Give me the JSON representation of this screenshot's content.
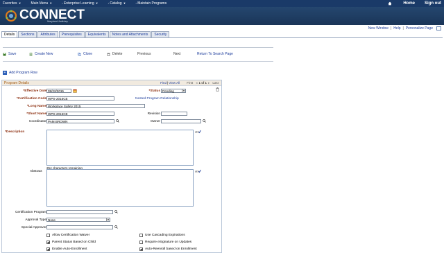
{
  "topnav": {
    "items": [
      {
        "label": "Favorites"
      },
      {
        "label": "Main Menu"
      },
      {
        "label": "Enterprise Learning"
      },
      {
        "label": "Catalog"
      },
      {
        "label": "Maintain Programs"
      }
    ],
    "home_label": "Home",
    "signout_label": "Sign out"
  },
  "brand": {
    "name": "CONNECT",
    "subtitle": "Maryland Judiciary"
  },
  "links": {
    "new_window": "New Window",
    "help": "Help",
    "personalize": "Personalize Page",
    "sep": "|"
  },
  "tabs": [
    {
      "label": "Details",
      "active": true
    },
    {
      "label": "Sections"
    },
    {
      "label": "Attributes"
    },
    {
      "label": "Prerequisites"
    },
    {
      "label": "Equivalents"
    },
    {
      "label": "Notes and Attachments"
    },
    {
      "label": "Security"
    }
  ],
  "toolbar": {
    "save": "Save",
    "create_new": "Create New",
    "clone": "Clone",
    "delete": "Delete",
    "previous": "Previous",
    "next": "Next",
    "return_search": "Return To Search Page"
  },
  "add_program_row": "Add Program Row",
  "program_details": {
    "title": "Program Details",
    "nav": {
      "find": "Find",
      "view_all": "View All",
      "first": "First",
      "pager": "1 of 1",
      "last": "Last"
    },
    "effective_date": {
      "label": "*Effective Date",
      "value": "09/22/2015"
    },
    "status": {
      "label": "*Status",
      "value": "Pending"
    },
    "cert_code": {
      "label": "*Certification Code",
      "value": "WPS-2015CE"
    },
    "nested_link": "Nested Program Relationship",
    "long_name": {
      "label": "*Long Name",
      "value": "Workplace Safety 2015"
    },
    "short_name": {
      "label": "*Short Name",
      "value": "WPS-2015CE"
    },
    "revision": {
      "label": "Revision",
      "value": ""
    },
    "coordinator": {
      "label": "Coordinator",
      "value": "PAM BROWN"
    },
    "owner": {
      "label": "Owner",
      "value": ""
    },
    "description": {
      "label": "*Description",
      "value": ""
    },
    "chars_remaining": "254 characters remaining",
    "abstract": {
      "label": "Abstract",
      "value": ""
    },
    "cert_program": {
      "label": "Certification Program",
      "value": ""
    },
    "approval_type": {
      "label": "Approval Type",
      "value": "None"
    },
    "special_approver": {
      "label": "Special Approver",
      "value": ""
    },
    "checkboxes": [
      {
        "label": "Allow Certification Waiver",
        "checked": false
      },
      {
        "label": "Use Cascading Expirations",
        "checked": false
      },
      {
        "label": "Parent Status Based on Child",
        "checked": true
      },
      {
        "label": "Require eSignature on Updates",
        "checked": false
      },
      {
        "label": "Enable Auto-Enrollment",
        "checked": true
      },
      {
        "label": "Auto-Reenroll based on Enrollment",
        "checked": true
      }
    ]
  },
  "colors": {
    "nav_bg": "#1a3a68",
    "link": "#1a3a9a",
    "section_title": "#a35a0e"
  }
}
